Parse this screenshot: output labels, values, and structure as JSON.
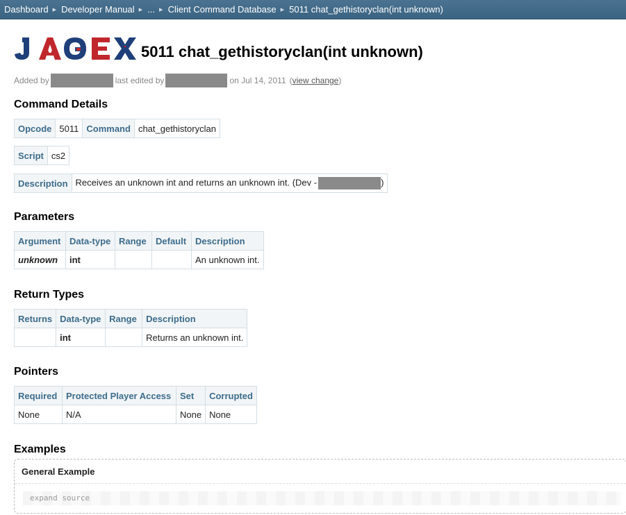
{
  "breadcrumb": [
    "Dashboard",
    "Developer Manual",
    "...",
    "Client Command Database",
    "5011 chat_gethistoryclan(int unknown)"
  ],
  "logo_text": "JAGEX",
  "page_title": "5011 chat_gethistoryclan(int unknown)",
  "meta": {
    "added_by_label": "Added by",
    "last_edited_label": "last edited by",
    "date_text": "on Jul 14, 2011",
    "view_change": "view change"
  },
  "sections": {
    "command_details": "Command Details",
    "parameters": "Parameters",
    "return_types": "Return Types",
    "pointers": "Pointers",
    "examples": "Examples"
  },
  "details": {
    "opcode_label": "Opcode",
    "opcode": "5011",
    "command_label": "Command",
    "command": "chat_gethistoryclan",
    "script_label": "Script",
    "script": "cs2",
    "description_label": "Description",
    "description": "Receives an unknown int and returns an unknown int. (Dev -",
    "description_tail": ")"
  },
  "parameters": {
    "headers": [
      "Argument",
      "Data-type",
      "Range",
      "Default",
      "Description"
    ],
    "rows": [
      [
        "unknown",
        "int",
        "",
        "",
        "An unknown int."
      ]
    ]
  },
  "return_types": {
    "headers": [
      "Returns",
      "Data-type",
      "Range",
      "Description"
    ],
    "rows": [
      [
        "",
        "int",
        "",
        "Returns an unknown int."
      ]
    ]
  },
  "pointers": {
    "headers": [
      "Required",
      "Protected Player Access",
      "Set",
      "Corrupted"
    ],
    "rows": [
      [
        "None",
        "N/A",
        "None",
        "None"
      ]
    ]
  },
  "example": {
    "title": "General Example",
    "expand": "expand source"
  },
  "colors": {
    "header_bar": "#4b7391",
    "table_header_text": "#3d6c8c",
    "logo_blue": "#1e3f7a",
    "logo_red": "#c0272d"
  }
}
